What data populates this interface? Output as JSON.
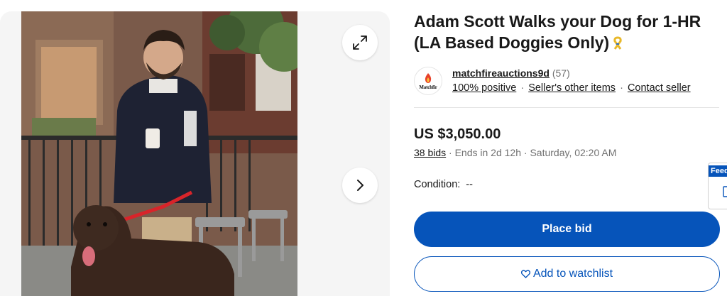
{
  "gallery": {
    "expand_icon": "expand-icon",
    "next_icon": "chevron-right-icon"
  },
  "listing": {
    "title": "Adam Scott Walks your Dog for 1-HR (LA Based Doggies Only)",
    "ribbon_icon": "awareness-ribbon-icon"
  },
  "seller": {
    "logo_text": "Matchfir",
    "name": "matchfireauctions9d",
    "feedback_count": "(57)",
    "positive": "100% positive",
    "other_items": "Seller's other items",
    "contact": "Contact seller",
    "separator": "·"
  },
  "pricing": {
    "price": "US $3,050.00",
    "bids": "38 bids",
    "ends": "· Ends in 2d 12h · Saturday, 02:20 AM"
  },
  "condition": {
    "label": "Condition:",
    "value": "--"
  },
  "actions": {
    "place_bid": "Place bid",
    "watchlist": "Add to watchlist"
  },
  "feedback_tab": {
    "label": "Feedback"
  },
  "colors": {
    "primary_blue": "#0654ba",
    "text": "#191919",
    "muted": "#707070",
    "gallery_bg": "#f5f5f5"
  }
}
